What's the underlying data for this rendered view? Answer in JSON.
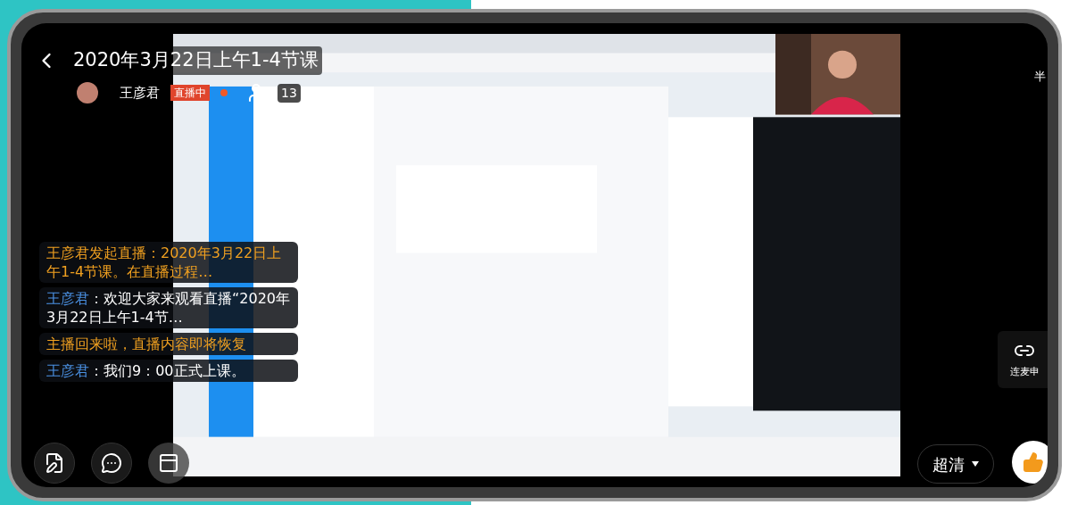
{
  "header": {
    "title": "2020年3月22日上午1-4节课",
    "host": "王彦君",
    "live_badge": "直播中",
    "viewers": "13",
    "edge_text": "半"
  },
  "chat": [
    {
      "kind": "system",
      "text": "王彦君发起直播：2020年3月22日上午1-4节课。在直播过程…"
    },
    {
      "kind": "user",
      "name": "王彦君",
      "text": "：欢迎大家来观看直播“2020年3月22日上午1-4节…"
    },
    {
      "kind": "system",
      "text": "主播回来啦，直播内容即将恢复"
    },
    {
      "kind": "user",
      "name": "王彦君",
      "text": "：我们9：00正式上课。"
    }
  ],
  "mic_request": {
    "label": "连麦申"
  },
  "quality": {
    "label": "超清"
  }
}
